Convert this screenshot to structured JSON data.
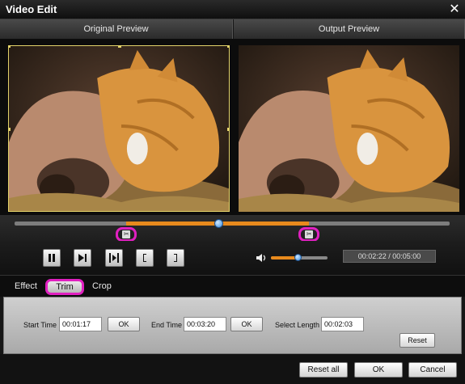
{
  "window": {
    "title": "Video Edit",
    "close_glyph": "✕"
  },
  "preview": {
    "original_label": "Original Preview",
    "output_label": "Output Preview"
  },
  "timeline": {
    "playhead_fraction": 0.47,
    "trim_start_fraction": 0.257,
    "trim_end_fraction": 0.677,
    "trim_icon": "scissors-icon"
  },
  "controls": {
    "buttons": [
      "pause",
      "next-frame",
      "play-segment",
      "mark-in",
      "mark-out"
    ],
    "volume_fraction": 0.48,
    "timecode": "00:02:22 / 00:05:00"
  },
  "tabs": [
    "Effect",
    "Trim",
    "Crop"
  ],
  "trim": {
    "start_label": "Start Time",
    "start_value": "00:01:17",
    "start_ok": "OK",
    "end_label": "End Time",
    "end_value": "00:03:20",
    "end_ok": "OK",
    "length_label": "Select Length",
    "length_value": "00:02:03",
    "reset_label": "Reset"
  },
  "footer": {
    "reset_all": "Reset all",
    "ok": "OK",
    "cancel": "Cancel"
  },
  "colors": {
    "accent": "#e88a1d",
    "highlight": "#e020c0",
    "knob": "#3b8de0"
  }
}
